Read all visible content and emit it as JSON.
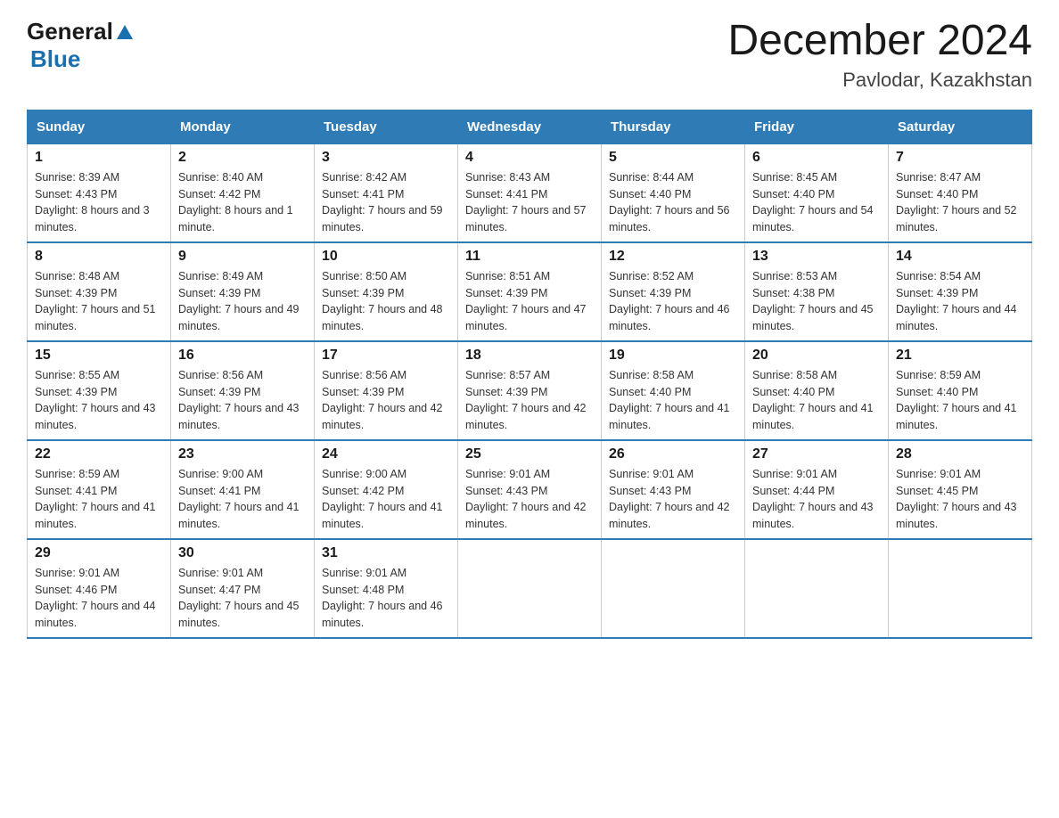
{
  "header": {
    "logo": {
      "general": "General",
      "blue": "Blue"
    },
    "title": "December 2024",
    "location": "Pavlodar, Kazakhstan"
  },
  "calendar": {
    "days_of_week": [
      "Sunday",
      "Monday",
      "Tuesday",
      "Wednesday",
      "Thursday",
      "Friday",
      "Saturday"
    ],
    "weeks": [
      [
        {
          "day": "1",
          "sunrise": "8:39 AM",
          "sunset": "4:43 PM",
          "daylight": "8 hours and 3 minutes."
        },
        {
          "day": "2",
          "sunrise": "8:40 AM",
          "sunset": "4:42 PM",
          "daylight": "8 hours and 1 minute."
        },
        {
          "day": "3",
          "sunrise": "8:42 AM",
          "sunset": "4:41 PM",
          "daylight": "7 hours and 59 minutes."
        },
        {
          "day": "4",
          "sunrise": "8:43 AM",
          "sunset": "4:41 PM",
          "daylight": "7 hours and 57 minutes."
        },
        {
          "day": "5",
          "sunrise": "8:44 AM",
          "sunset": "4:40 PM",
          "daylight": "7 hours and 56 minutes."
        },
        {
          "day": "6",
          "sunrise": "8:45 AM",
          "sunset": "4:40 PM",
          "daylight": "7 hours and 54 minutes."
        },
        {
          "day": "7",
          "sunrise": "8:47 AM",
          "sunset": "4:40 PM",
          "daylight": "7 hours and 52 minutes."
        }
      ],
      [
        {
          "day": "8",
          "sunrise": "8:48 AM",
          "sunset": "4:39 PM",
          "daylight": "7 hours and 51 minutes."
        },
        {
          "day": "9",
          "sunrise": "8:49 AM",
          "sunset": "4:39 PM",
          "daylight": "7 hours and 49 minutes."
        },
        {
          "day": "10",
          "sunrise": "8:50 AM",
          "sunset": "4:39 PM",
          "daylight": "7 hours and 48 minutes."
        },
        {
          "day": "11",
          "sunrise": "8:51 AM",
          "sunset": "4:39 PM",
          "daylight": "7 hours and 47 minutes."
        },
        {
          "day": "12",
          "sunrise": "8:52 AM",
          "sunset": "4:39 PM",
          "daylight": "7 hours and 46 minutes."
        },
        {
          "day": "13",
          "sunrise": "8:53 AM",
          "sunset": "4:38 PM",
          "daylight": "7 hours and 45 minutes."
        },
        {
          "day": "14",
          "sunrise": "8:54 AM",
          "sunset": "4:39 PM",
          "daylight": "7 hours and 44 minutes."
        }
      ],
      [
        {
          "day": "15",
          "sunrise": "8:55 AM",
          "sunset": "4:39 PM",
          "daylight": "7 hours and 43 minutes."
        },
        {
          "day": "16",
          "sunrise": "8:56 AM",
          "sunset": "4:39 PM",
          "daylight": "7 hours and 43 minutes."
        },
        {
          "day": "17",
          "sunrise": "8:56 AM",
          "sunset": "4:39 PM",
          "daylight": "7 hours and 42 minutes."
        },
        {
          "day": "18",
          "sunrise": "8:57 AM",
          "sunset": "4:39 PM",
          "daylight": "7 hours and 42 minutes."
        },
        {
          "day": "19",
          "sunrise": "8:58 AM",
          "sunset": "4:40 PM",
          "daylight": "7 hours and 41 minutes."
        },
        {
          "day": "20",
          "sunrise": "8:58 AM",
          "sunset": "4:40 PM",
          "daylight": "7 hours and 41 minutes."
        },
        {
          "day": "21",
          "sunrise": "8:59 AM",
          "sunset": "4:40 PM",
          "daylight": "7 hours and 41 minutes."
        }
      ],
      [
        {
          "day": "22",
          "sunrise": "8:59 AM",
          "sunset": "4:41 PM",
          "daylight": "7 hours and 41 minutes."
        },
        {
          "day": "23",
          "sunrise": "9:00 AM",
          "sunset": "4:41 PM",
          "daylight": "7 hours and 41 minutes."
        },
        {
          "day": "24",
          "sunrise": "9:00 AM",
          "sunset": "4:42 PM",
          "daylight": "7 hours and 41 minutes."
        },
        {
          "day": "25",
          "sunrise": "9:01 AM",
          "sunset": "4:43 PM",
          "daylight": "7 hours and 42 minutes."
        },
        {
          "day": "26",
          "sunrise": "9:01 AM",
          "sunset": "4:43 PM",
          "daylight": "7 hours and 42 minutes."
        },
        {
          "day": "27",
          "sunrise": "9:01 AM",
          "sunset": "4:44 PM",
          "daylight": "7 hours and 43 minutes."
        },
        {
          "day": "28",
          "sunrise": "9:01 AM",
          "sunset": "4:45 PM",
          "daylight": "7 hours and 43 minutes."
        }
      ],
      [
        {
          "day": "29",
          "sunrise": "9:01 AM",
          "sunset": "4:46 PM",
          "daylight": "7 hours and 44 minutes."
        },
        {
          "day": "30",
          "sunrise": "9:01 AM",
          "sunset": "4:47 PM",
          "daylight": "7 hours and 45 minutes."
        },
        {
          "day": "31",
          "sunrise": "9:01 AM",
          "sunset": "4:48 PM",
          "daylight": "7 hours and 46 minutes."
        },
        null,
        null,
        null,
        null
      ]
    ]
  }
}
